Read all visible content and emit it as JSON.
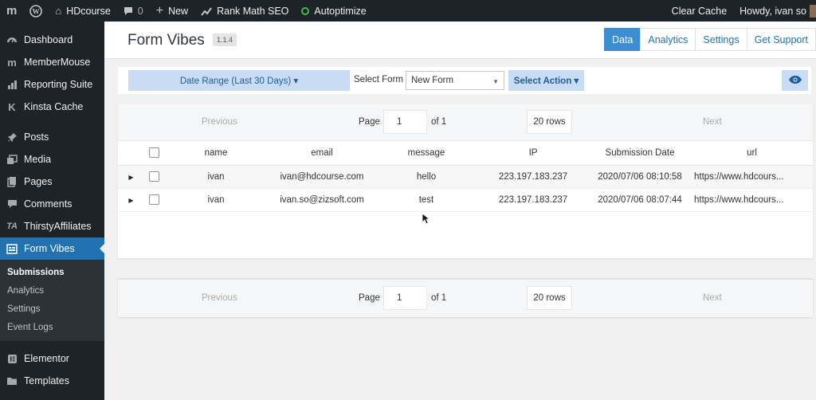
{
  "adminbar": {
    "site_name": "HDcourse",
    "comments_count": "0",
    "new_label": "New",
    "rankmath_label": "Rank Math SEO",
    "autoptimize_label": "Autoptimize",
    "clear_cache_label": "Clear Cache",
    "howdy_label": "Howdy, ivan so"
  },
  "sidebar": {
    "items": [
      {
        "label": "Dashboard",
        "icon": "dashboard-icon"
      },
      {
        "label": "MemberMouse",
        "icon": "membermouse-icon"
      },
      {
        "label": "Reporting Suite",
        "icon": "chart-icon"
      },
      {
        "label": "Kinsta Cache",
        "icon": "kinsta-icon"
      },
      {
        "label": "Posts",
        "icon": "pin-icon"
      },
      {
        "label": "Media",
        "icon": "media-icon"
      },
      {
        "label": "Pages",
        "icon": "pages-icon"
      },
      {
        "label": "Comments",
        "icon": "comment-icon"
      },
      {
        "label": "ThirstyAffiliates",
        "icon": "ta-icon"
      },
      {
        "label": "Form Vibes",
        "icon": "form-icon"
      },
      {
        "label": "Elementor",
        "icon": "elementor-icon"
      },
      {
        "label": "Templates",
        "icon": "folder-icon"
      }
    ],
    "submenu": [
      "Submissions",
      "Analytics",
      "Settings",
      "Event Logs"
    ]
  },
  "header": {
    "title": "Form Vibes",
    "version": "1.1.4",
    "tabs": [
      "Data",
      "Analytics",
      "Settings",
      "Get Support"
    ]
  },
  "filters": {
    "date_range": "Date Range (Last 30 Days) ▾",
    "select_form_label": "Select Form",
    "select_form_value": "New Form",
    "select_action": "Select Action ▾"
  },
  "pager": {
    "previous": "Previous",
    "page_label": "Page",
    "page_value": "1",
    "of_label": "of 1",
    "rows": "20 rows",
    "next": "Next"
  },
  "table": {
    "columns": [
      "name",
      "email",
      "message",
      "IP",
      "Submission Date",
      "url"
    ],
    "rows": [
      [
        "ivan",
        "ivan@hdcourse.com",
        "hello",
        "223.197.183.237",
        "2020/07/06 08:10:58",
        "https://www.hdcours..."
      ],
      [
        "ivan",
        "ivan.so@zizsoft.com",
        "test",
        "223.197.183.237",
        "2020/07/06 08:07:44",
        "https://www.hdcours..."
      ]
    ]
  },
  "colors": {
    "admin_dark": "#1d2327",
    "accent": "#2271b1",
    "tab_active": "#3c8dd1",
    "filter_button": "#c8dcf3"
  }
}
